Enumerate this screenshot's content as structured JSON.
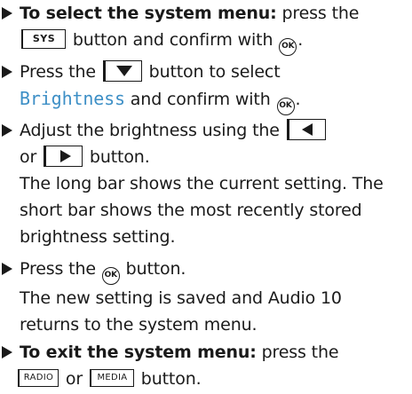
{
  "steps": [
    {
      "lead": "To select the system menu:",
      "text_a": " press the",
      "key": "SYS",
      "text_b": " button and confirm with ",
      "ok": "OK",
      "text_c": "."
    },
    {
      "text_a": "Press the ",
      "key_icon": "down-arrow-icon",
      "text_b": " button to select",
      "display": "Brightness",
      "text_c": " and confirm with ",
      "ok": "OK",
      "text_d": "."
    },
    {
      "text_a": "Adjust the brightness using the ",
      "key_icon_a": "left-arrow-icon",
      "text_b": "or ",
      "key_icon_b": "right-arrow-icon",
      "text_c": " button.",
      "line_3": "The long bar shows the current setting. The",
      "line_4": "short bar shows the most recently stored",
      "line_5": "brightness setting."
    },
    {
      "text_a": "Press the ",
      "ok": "OK",
      "text_b": " button.",
      "line_2": "The new setting is saved and Audio 10",
      "line_3": "returns to the system menu."
    },
    {
      "lead": "To exit the system menu:",
      "text_a": " press the",
      "key_a": "RADIO",
      "text_b": " or ",
      "key_b": "MEDIA",
      "text_c": " button."
    }
  ],
  "colors": {
    "display_text": "#3d8fc6",
    "text": "#1a1a1a"
  }
}
